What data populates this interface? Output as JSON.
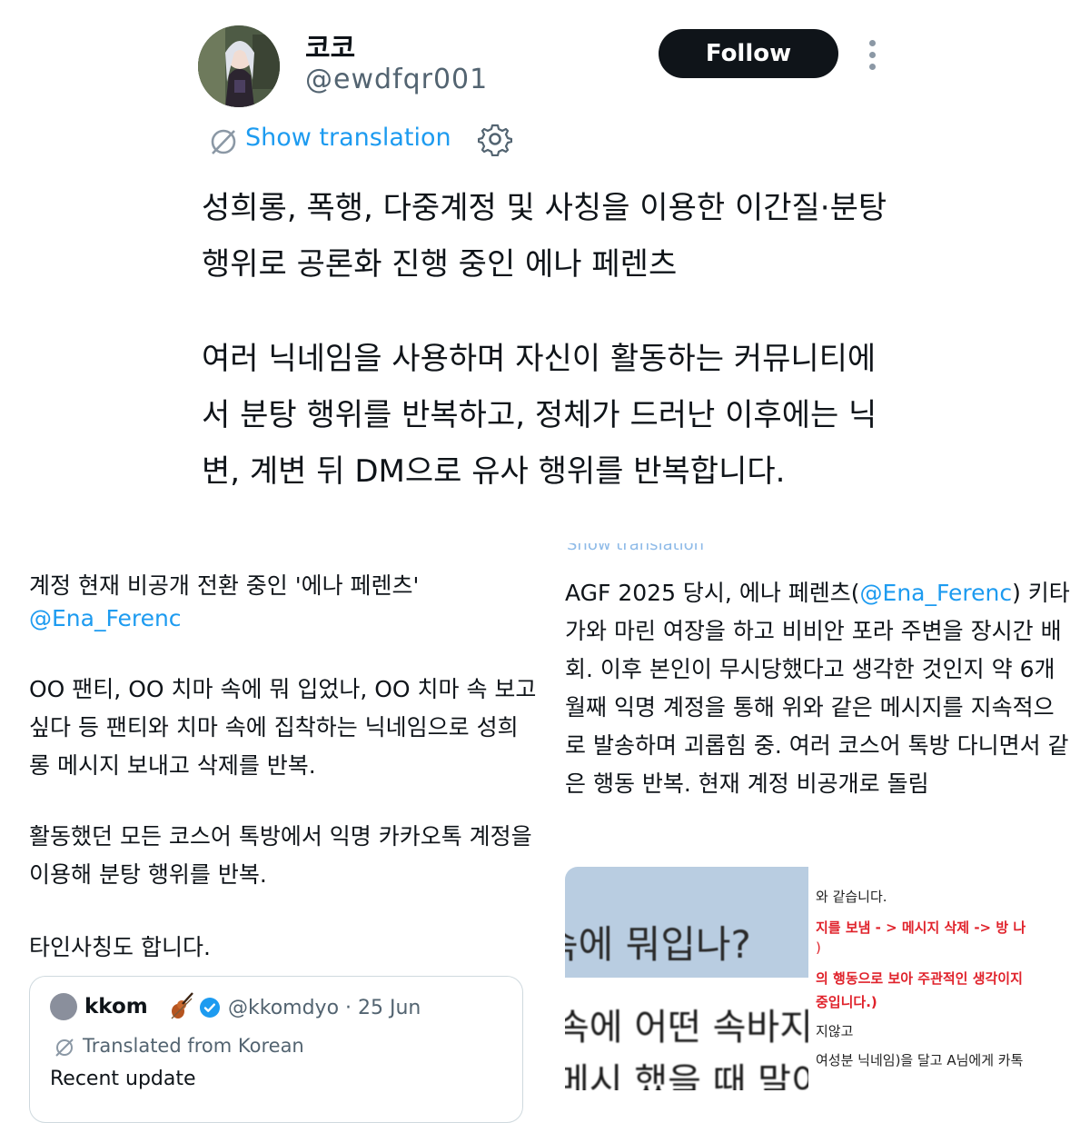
{
  "top_tweet": {
    "display_name": "코코",
    "handle": "@ewdfqr001",
    "follow_label": "Follow",
    "show_translation": "Show translation",
    "paragraph1": "성희롱, 폭행, 다중계정 및 사칭을 이용한 이간질·분탕 행위로 공론화 진행 중인 에나 페렌츠",
    "paragraph2": "여러 닉네임을 사용하며 자신이 활동하는 커뮤니티에서 분탕 행위를 반복하고, 정체가 드러난 이후에는 닉변, 계변 뒤 DM으로 유사 행위를 반복합니다."
  },
  "left_panel": {
    "line1": "계정 현재 비공개 전환 중인 '에나 페렌츠'",
    "mention": "@Ena_Ferenc",
    "para2": "OO 팬티, OO 치마 속에 뭐 입었나, OO 치마 속 보고 싶다 등 팬티와 치마 속에 집착하는 닉네임으로 성희롱 메시지 보내고 삭제를 반복.",
    "para3": "활동했던 모든 코스어 톡방에서 익명 카카오톡 계정을 이용해 분탕 행위를 반복.",
    "para4": "타인사칭도 합니다.",
    "quote": {
      "name": "kkom",
      "handle_date": "@kkomdyo · 25 Jun",
      "translated": "Translated from Korean",
      "cut_text": "Recent update"
    }
  },
  "right_panel": {
    "cut_text": "Show translation",
    "text_before": "AGF 2025 당시, 에나 페렌츠(",
    "mention": "@Ena_Ferenc",
    "text_after": ") 키타가와 마린 여장을 하고 비비안 포라 주변을 장시간 배회. 이후 본인이 무시당했다고 생각한 것인지 약 6개월째 익명 계정을 통해 위와 같은 메시지를 지속적으로 발송하며 괴롭힘 중. 여러 코스어 톡방 다니면서 같은 행동 반복. 현재 계정 비공개로 돌림",
    "image": {
      "left_question": "속에 뭐입나?",
      "left_line2": "속에 어떤 속바지",
      "left_line3": "메시 했을 때 말이",
      "right_lines": [
        "와 같습니다.",
        "지를 보냄 - > 메시지 삭제 -> 방 나",
        ")",
        "의 행동으로 보아 주관적인 생각이지",
        "중입니다.)",
        "지않고",
        "여성분 닉네임)을 달고 A님에게 카톡"
      ]
    }
  },
  "colors": {
    "link": "#1d9bf0",
    "text": "#0f1419",
    "secondary": "#536471",
    "follow_bg": "#0f1419",
    "warning_red": "#e0222b"
  }
}
